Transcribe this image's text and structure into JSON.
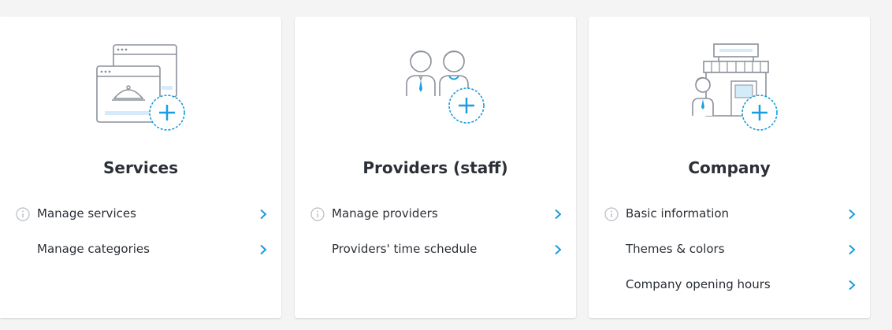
{
  "colors": {
    "accent": "#1a9ce0",
    "line": "#8b909a",
    "light_fill": "#d4ecfa",
    "title": "#2b2f36"
  },
  "cards": [
    {
      "title": "Services",
      "illustration": "services-window-plus-icon",
      "items": [
        {
          "label": "Manage services",
          "info": true
        },
        {
          "label": "Manage categories",
          "info": false
        }
      ]
    },
    {
      "title": "Providers (staff)",
      "illustration": "providers-people-plus-icon",
      "items": [
        {
          "label": "Manage providers",
          "info": true
        },
        {
          "label": "Providers' time schedule",
          "info": false
        }
      ]
    },
    {
      "title": "Company",
      "illustration": "company-shop-plus-icon",
      "items": [
        {
          "label": "Basic information",
          "info": true
        },
        {
          "label": "Themes & colors",
          "info": false
        },
        {
          "label": "Company opening hours",
          "info": false
        }
      ]
    }
  ]
}
